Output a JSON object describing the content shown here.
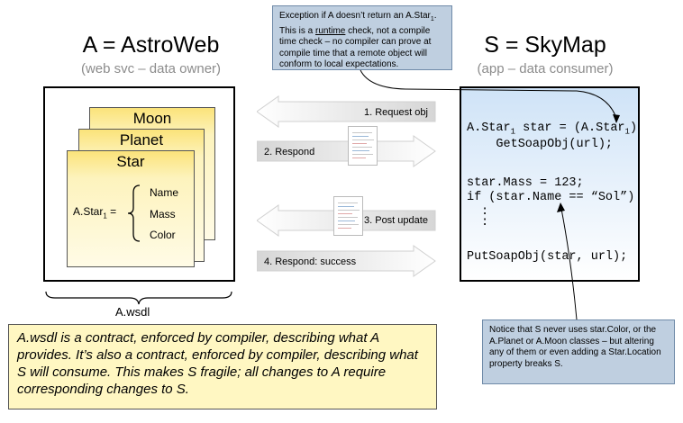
{
  "left": {
    "title": "A = AstroWeb",
    "subtitle": "(web svc – data owner)",
    "cards": [
      "Moon",
      "Planet",
      "Star"
    ],
    "star_type": {
      "prefix": "A.Star",
      "subscript": "1",
      "suffix": " ="
    },
    "fields": [
      "Name",
      "Mass",
      "Color"
    ],
    "wsdl_label": "A.wsdl"
  },
  "right": {
    "title": "S = SkyMap",
    "subtitle": "(app – data consumer)",
    "code": {
      "line1_a": "A.Star",
      "line1_sub1": "1",
      "line1_b": " star = (A.Star",
      "line1_sub2": "1",
      "line1_c": ")",
      "line2": "    GetSoapObj(url);",
      "line3": "star.Mass = 123;",
      "line4": "if (star.Name == “Sol”)",
      "line5": ":",
      "line6": ":",
      "line7": "PutSoapObj(star, url);"
    }
  },
  "arrows": [
    {
      "label": "1. Request obj"
    },
    {
      "label": "2. Respond"
    },
    {
      "label": "3. Post update"
    },
    {
      "label": "4. Respond: success"
    }
  ],
  "top_note": {
    "part1": "Exception if A doesn’t return an A.Star",
    "sub": "1",
    "part2": ". This is a ",
    "underlined": "runtime",
    "part3": " check, not a compile time check – no compiler can prove at compile time that a remote object will conform to local expectations."
  },
  "bottom_note": "Notice that S never uses star.Color, or the A.Planet or A.Moon classes – but altering any of them or even adding a Star.Location property breaks S.",
  "summary": "A.wsdl is a contract, enforced by compiler, describing what A provides. It’s also a contract, enforced by compiler, describing what S will consume. This makes S fragile; all changes to A require corresponding changes to S.",
  "colors": {
    "card_fill": "#fbe37a",
    "code_bg": "#cfe3f7",
    "note_bg": "#bfcfe0",
    "summary_bg": "#fff7c2",
    "arrow_fill": "#e9e9e9"
  }
}
